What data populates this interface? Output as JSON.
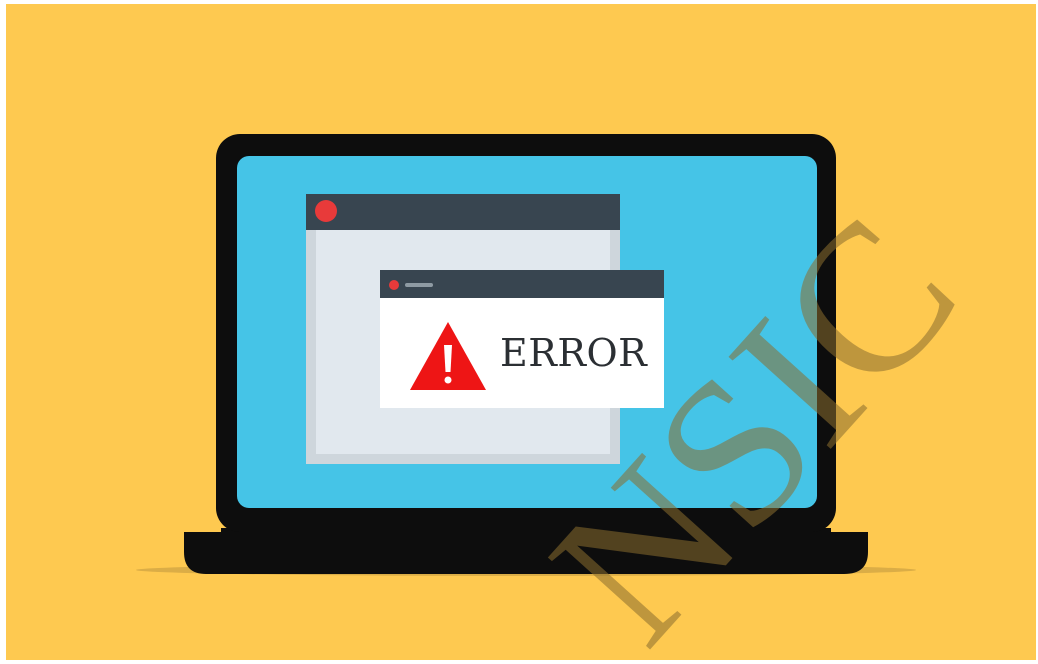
{
  "illustration": {
    "error_text": "ERROR",
    "watermark_text": "NSIC",
    "colors": {
      "background": "#FEC950",
      "laptop_body": "#0D0D0D",
      "screen": "#45C4E7",
      "window_titlebar": "#384550",
      "back_window_frame": "#CED6DC",
      "back_window_body": "#E1E8EE",
      "dialog_body": "#FFFFFF",
      "close_dot": "#E83A3A",
      "warning_triangle": "#EE1515",
      "warning_mark": "#FFFFFF",
      "shadow": "#C9A03C",
      "watermark": "#8B6E2F"
    },
    "icons": [
      "close-dot-icon",
      "minimize-dash-icon",
      "warning-triangle-icon"
    ]
  }
}
